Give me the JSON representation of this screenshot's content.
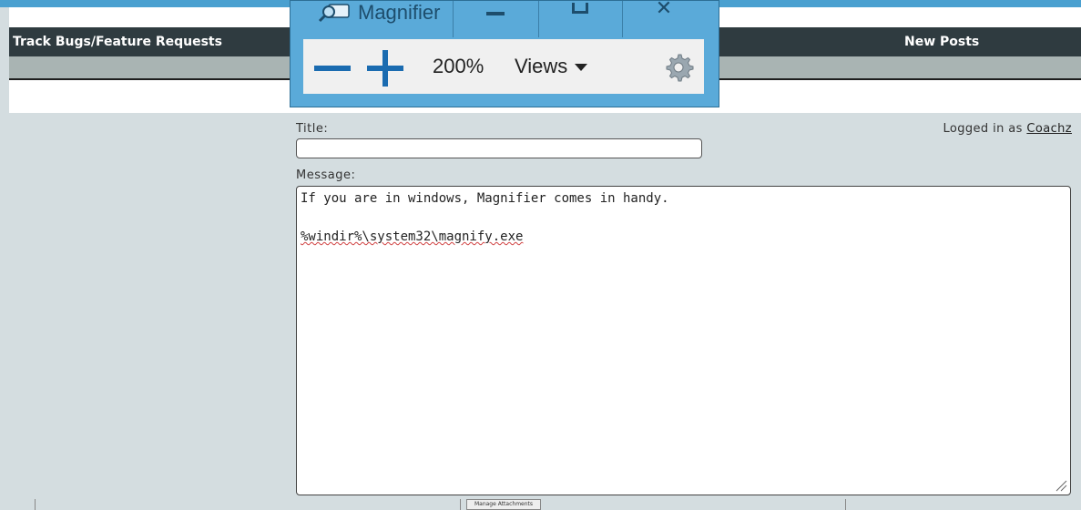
{
  "forum": {
    "nav_left": "Track Bugs/Feature Requests",
    "nav_right": "New Posts",
    "title_label": "Title:",
    "title_value": "",
    "message_label": "Message:",
    "message_lines": [
      "If you are in windows, Magnifier comes in handy.",
      "",
      "%windir%\\system32\\magnify.exe"
    ],
    "logged_in_prefix": "Logged in as",
    "username": "Coachz",
    "manage_attachments": "Manage Attachments"
  },
  "magnifier": {
    "title": "Magnifier",
    "zoom_level": "200%",
    "views_label": "Views",
    "icons": {
      "app": "magnifier-icon",
      "minimize": "minimize-icon",
      "maximize": "maximize-icon",
      "close": "close-icon",
      "zoom_out": "zoom-out-icon",
      "zoom_in": "zoom-in-icon",
      "settings": "gear-icon"
    }
  },
  "colors": {
    "navbar": "#2f3b40",
    "magnifier_frame": "#5aaad9",
    "accent_blue": "#1a6bb0"
  }
}
